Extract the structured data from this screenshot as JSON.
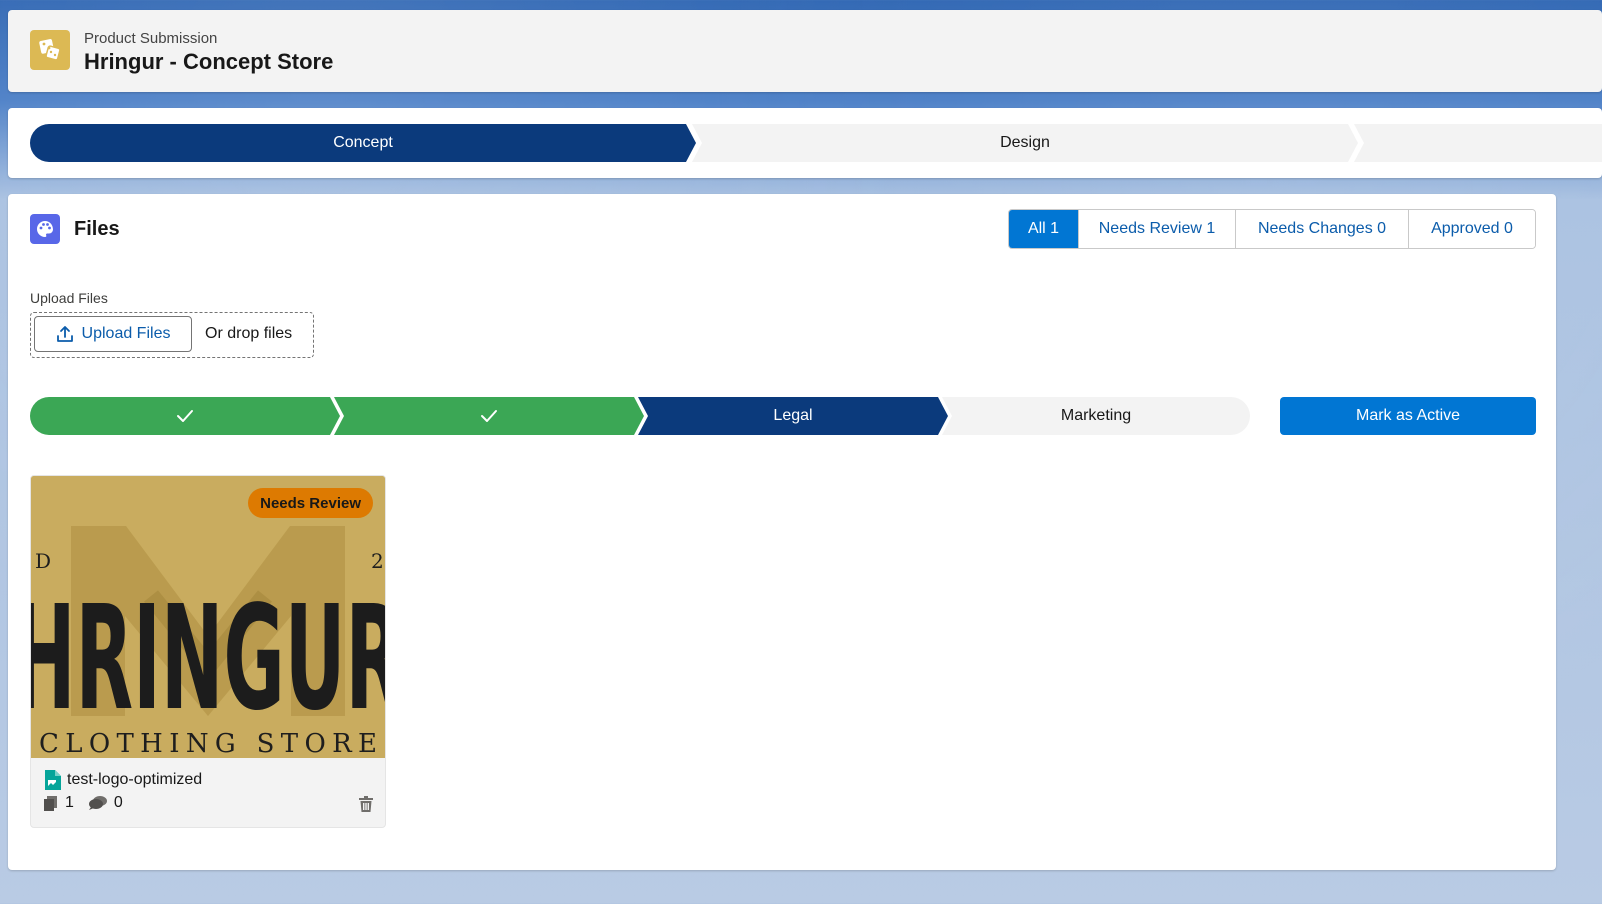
{
  "header": {
    "subtitle": "Product Submission",
    "title": "Hringur - Concept Store",
    "icon": "product-icon"
  },
  "top_path": {
    "stages": [
      {
        "label": "Concept",
        "state": "current"
      },
      {
        "label": "Design",
        "state": "incomplete"
      },
      {
        "label": "",
        "state": "incomplete"
      }
    ]
  },
  "files_panel": {
    "title": "Files",
    "icon": "palette-icon",
    "filters": [
      {
        "label": "All 1",
        "active": true
      },
      {
        "label": "Needs Review 1",
        "active": false
      },
      {
        "label": "Needs Changes 0",
        "active": false
      },
      {
        "label": "Approved 0",
        "active": false
      }
    ],
    "upload": {
      "label": "Upload Files",
      "button_label": "Upload Files",
      "drop_text": "Or drop files"
    },
    "sub_path": {
      "stages": [
        {
          "label": "",
          "state": "complete"
        },
        {
          "label": "",
          "state": "complete"
        },
        {
          "label": "Legal",
          "state": "current"
        },
        {
          "label": "Marketing",
          "state": "incomplete"
        }
      ],
      "action_label": "Mark as Active"
    },
    "file_card": {
      "status": "Needs Review",
      "file_name": "test-logo-optimized",
      "versions": "1",
      "comments": "0",
      "logo": {
        "top_left": "D",
        "top_right": "2",
        "brand": "HRINGUR",
        "tagline": "CLOTHING STORE"
      }
    }
  },
  "colors": {
    "brand_blue": "#0176d3",
    "path_current": "#0b3a7c",
    "path_complete": "#3ba755",
    "badge_warning": "#dd7a01"
  }
}
